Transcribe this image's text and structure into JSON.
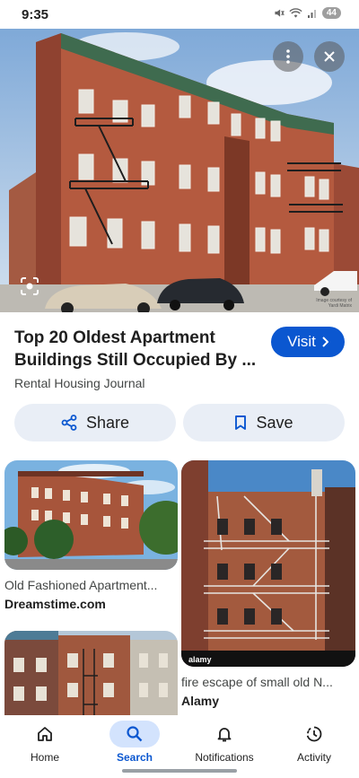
{
  "status_bar": {
    "time": "9:35",
    "battery": "44"
  },
  "hero": {
    "credit": "Image courtesy of Yardi Matrix",
    "more_icon": "more-vert-icon",
    "close_icon": "close-icon",
    "lens_icon": "lens-icon"
  },
  "result": {
    "title": "Top 20 Oldest Apartment Buildings Still Occupied By ...",
    "source": "Rental Housing Journal",
    "visit_label": "Visit"
  },
  "actions": {
    "share_label": "Share",
    "save_label": "Save"
  },
  "grid": [
    {
      "title": "Old Fashioned Apartment...",
      "source": "Dreamstime.com"
    },
    {
      "title": "fire escape of small old N...",
      "source": "Alamy",
      "watermark": "alamy"
    },
    {
      "title": "",
      "source": ""
    }
  ],
  "nav": {
    "items": [
      {
        "label": "Home",
        "icon": "home-icon"
      },
      {
        "label": "Search",
        "icon": "search-icon",
        "active": true
      },
      {
        "label": "Notifications",
        "icon": "bell-icon"
      },
      {
        "label": "Activity",
        "icon": "activity-icon"
      }
    ]
  },
  "colors": {
    "accent": "#0b57d0",
    "chip": "#e9eef6",
    "nav_active": "#d3e3fd"
  }
}
